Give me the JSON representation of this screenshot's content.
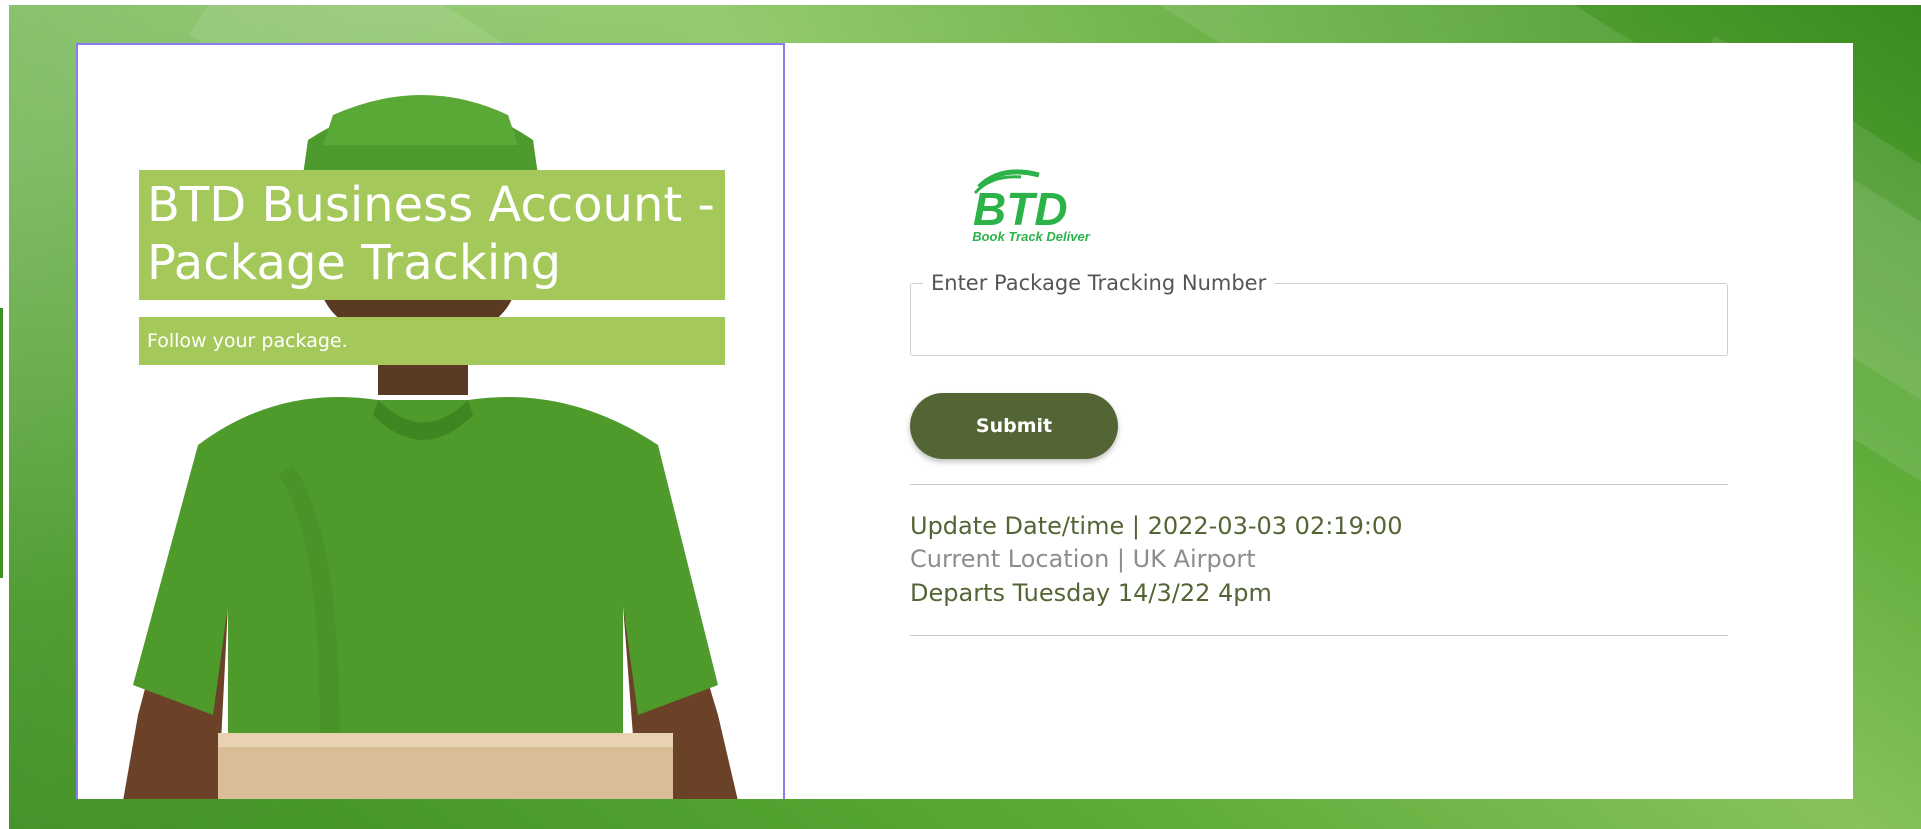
{
  "hero": {
    "title": "BTD Business Account - Package Tracking",
    "subtitle": "Follow your package."
  },
  "logo": {
    "mark": "BTD",
    "caption": "Book Track Deliver",
    "color": "#2bb34a"
  },
  "tracking_form": {
    "label": "Enter Package Tracking Number",
    "value": "",
    "submit_label": "Submit"
  },
  "status": {
    "update_line": "Update Date/time |  2022-03-03 02:19:00",
    "location_line": "Current Location | UK Airport",
    "departure_line": "Departs Tuesday 14/3/22 4pm"
  },
  "colors": {
    "accent_green": "#a5c85a",
    "button_dark_olive": "#546535",
    "hero_border": "#8a7cf0",
    "background_green": "#5aa936"
  }
}
